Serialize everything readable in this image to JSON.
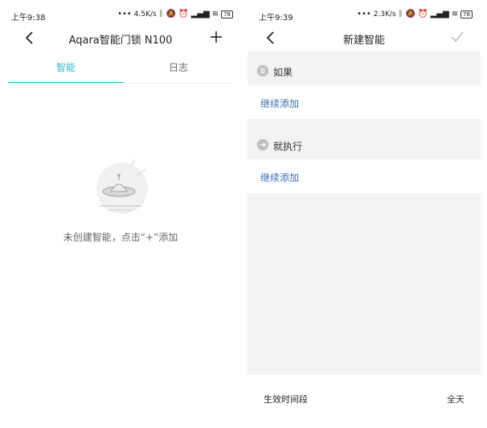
{
  "left": {
    "status": {
      "time": "上午9:38",
      "speed": "4.5K/s",
      "battery": "78"
    },
    "nav": {
      "title": "Aqara智能门锁 N100"
    },
    "tabs": [
      {
        "label": "智能"
      },
      {
        "label": "日志"
      }
    ],
    "empty_message": "未创建智能，点击“+”添加"
  },
  "right": {
    "status": {
      "time": "上午9:39",
      "speed": "2.3K/s",
      "battery": "78"
    },
    "nav": {
      "title": "新建智能"
    },
    "if_section": {
      "label": "如果",
      "add_label": "继续添加"
    },
    "then_section": {
      "label": "就执行",
      "add_label": "继续添加"
    },
    "effective_time": {
      "label": "生效时间段",
      "value": "全天"
    }
  },
  "colors": {
    "accent": "#2dbbc9",
    "link": "#3b6fb5"
  }
}
